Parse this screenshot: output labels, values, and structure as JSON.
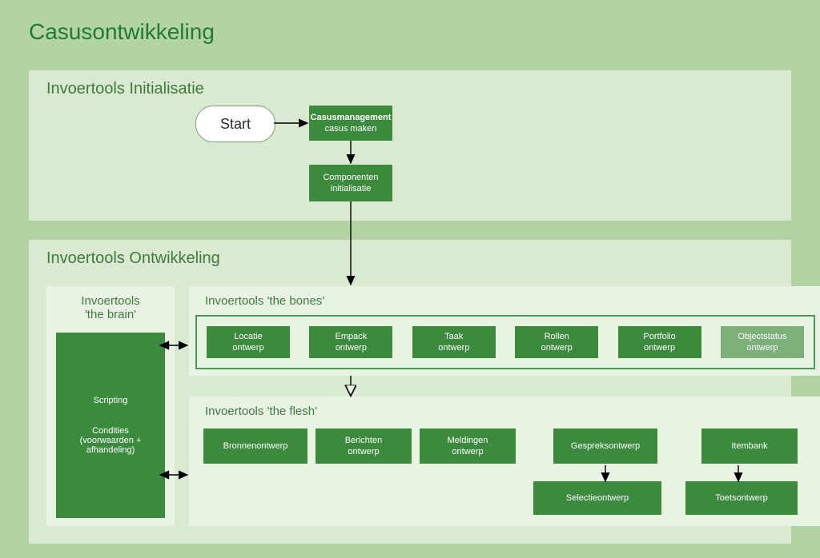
{
  "title": "Casusontwikkeling",
  "panels": {
    "init": {
      "title": "Invoertools Initialisatie"
    },
    "dev": {
      "title": "Invoertools Ontwikkeling"
    }
  },
  "start": {
    "label": "Start"
  },
  "casusmgmt": {
    "l1": "Casusmanagement",
    "l2": "casus maken"
  },
  "componenten": {
    "l1": "Componenten",
    "l2": "initialisatie"
  },
  "brain": {
    "title1": "Invoertools",
    "title2": "'the brain'",
    "scripting": "Scripting",
    "condities1": "Condities",
    "condities2": "(voorwaarden +",
    "condities3": "afhandeling)"
  },
  "bones": {
    "title": "Invoertools 'the bones'",
    "items": [
      {
        "l1": "Locatie",
        "l2": "ontwerp"
      },
      {
        "l1": "Empack",
        "l2": "ontwerp"
      },
      {
        "l1": "Taak",
        "l2": "ontwerp"
      },
      {
        "l1": "Rollen",
        "l2": "ontwerp"
      },
      {
        "l1": "Portfolio",
        "l2": "ontwerp"
      },
      {
        "l1": "Objectstatus",
        "l2": "ontwerp",
        "muted": true
      }
    ]
  },
  "flesh": {
    "title": "Invoertools 'the flesh'",
    "row1": [
      {
        "l1": "Bronnenontwerp"
      },
      {
        "l1": "Berichten",
        "l2": "ontwerp"
      },
      {
        "l1": "Meldingen",
        "l2": "ontwerp"
      },
      {
        "l1": "Gespreksontwerp"
      },
      {
        "l1": "Itembank"
      }
    ],
    "row2": [
      {
        "l1": "Selectieontwerp"
      },
      {
        "l1": "Toetsontwerp"
      }
    ]
  }
}
